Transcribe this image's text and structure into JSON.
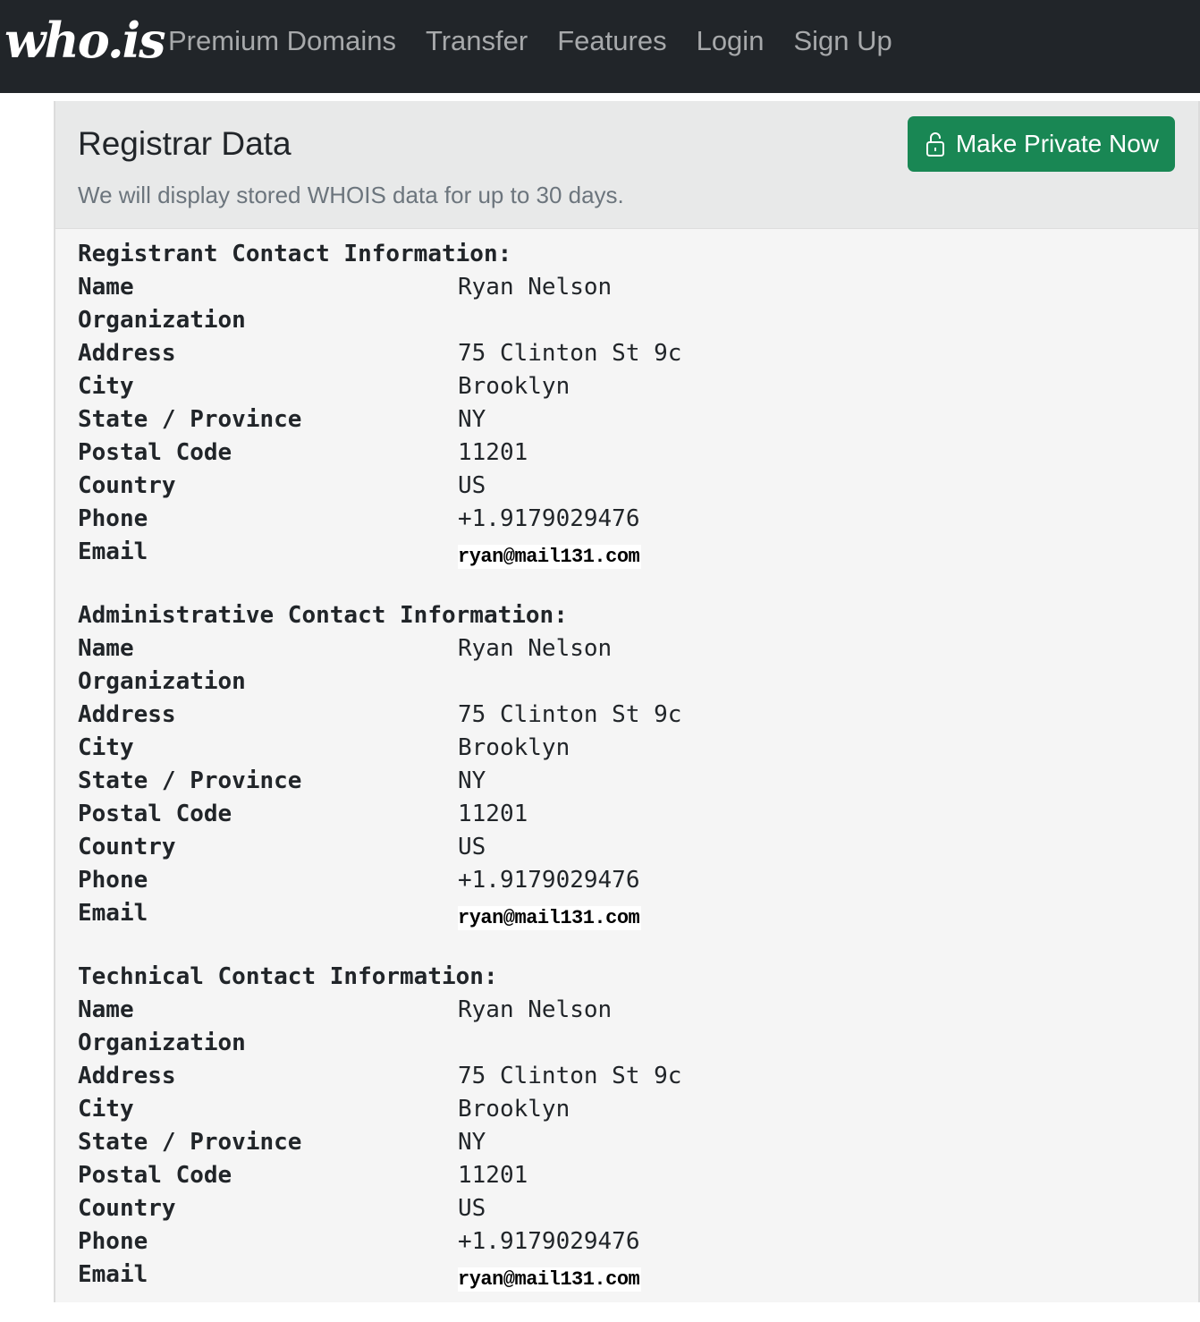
{
  "navbar": {
    "logo": "who.is",
    "links": [
      "Premium Domains",
      "Transfer",
      "Features",
      "Login",
      "Sign Up"
    ]
  },
  "card": {
    "title": "Registrar Data",
    "subtitle": "We will display stored WHOIS data for up to 30 days.",
    "private_button_label": "Make Private Now",
    "private_button_icon": "lock-icon",
    "button_color": "#198754"
  },
  "sections": [
    {
      "title": "Registrant Contact Information:",
      "rows": [
        {
          "label": "Name",
          "value": "Ryan Nelson"
        },
        {
          "label": "Organization",
          "value": ""
        },
        {
          "label": "Address",
          "value": "75 Clinton St 9c"
        },
        {
          "label": "City",
          "value": "Brooklyn"
        },
        {
          "label": "State / Province",
          "value": "NY"
        },
        {
          "label": "Postal Code",
          "value": "11201"
        },
        {
          "label": "Country",
          "value": "US"
        },
        {
          "label": "Phone",
          "value": "+1.9179029476"
        },
        {
          "label": "Email",
          "value": "ryan@mail131.com"
        }
      ]
    },
    {
      "title": "Administrative Contact Information:",
      "rows": [
        {
          "label": "Name",
          "value": "Ryan Nelson"
        },
        {
          "label": "Organization",
          "value": ""
        },
        {
          "label": "Address",
          "value": "75 Clinton St 9c"
        },
        {
          "label": "City",
          "value": "Brooklyn"
        },
        {
          "label": "State / Province",
          "value": "NY"
        },
        {
          "label": "Postal Code",
          "value": "11201"
        },
        {
          "label": "Country",
          "value": "US"
        },
        {
          "label": "Phone",
          "value": "+1.9179029476"
        },
        {
          "label": "Email",
          "value": "ryan@mail131.com"
        }
      ]
    },
    {
      "title": "Technical Contact Information:",
      "rows": [
        {
          "label": "Name",
          "value": "Ryan Nelson"
        },
        {
          "label": "Organization",
          "value": ""
        },
        {
          "label": "Address",
          "value": "75 Clinton St 9c"
        },
        {
          "label": "City",
          "value": "Brooklyn"
        },
        {
          "label": "State / Province",
          "value": "NY"
        },
        {
          "label": "Postal Code",
          "value": "11201"
        },
        {
          "label": "Country",
          "value": "US"
        },
        {
          "label": "Phone",
          "value": "+1.9179029476"
        },
        {
          "label": "Email",
          "value": "ryan@mail131.com"
        }
      ]
    }
  ]
}
